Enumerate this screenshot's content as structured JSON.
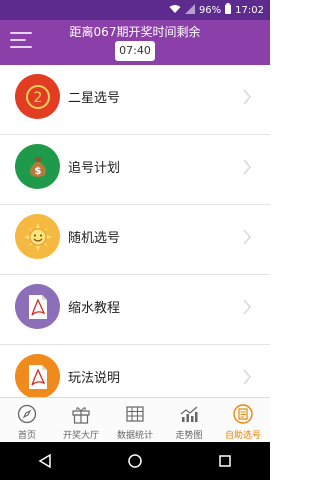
{
  "status_bar": {
    "battery": "96%",
    "time": "17:02"
  },
  "header": {
    "title": "距离067期开奖时间剩余",
    "countdown": "07:40"
  },
  "menu_items": [
    {
      "label": "二星选号",
      "icon": "two-star-icon",
      "color": "#e23c22"
    },
    {
      "label": "追号计划",
      "icon": "money-bag-icon",
      "color": "#1f9a4a"
    },
    {
      "label": "随机选号",
      "icon": "sun-face-icon",
      "color": "#f5b840"
    },
    {
      "label": "缩水教程",
      "icon": "pdf-document-icon",
      "color": "#8c6fb8"
    },
    {
      "label": "玩法说明",
      "icon": "pdf-document-icon",
      "color": "#f08a1c"
    }
  ],
  "tabs": [
    {
      "label": "首页",
      "icon": "compass-icon"
    },
    {
      "label": "开奖大厅",
      "icon": "gift-icon"
    },
    {
      "label": "数据统计",
      "icon": "grid-table-icon"
    },
    {
      "label": "走势图",
      "icon": "trend-chart-icon"
    },
    {
      "label": "自助选号",
      "icon": "document-icon",
      "active": true
    }
  ],
  "colors": {
    "header": "#8b3fa8",
    "status_bar": "#5d2b8e",
    "active_tab": "#e8860c"
  }
}
